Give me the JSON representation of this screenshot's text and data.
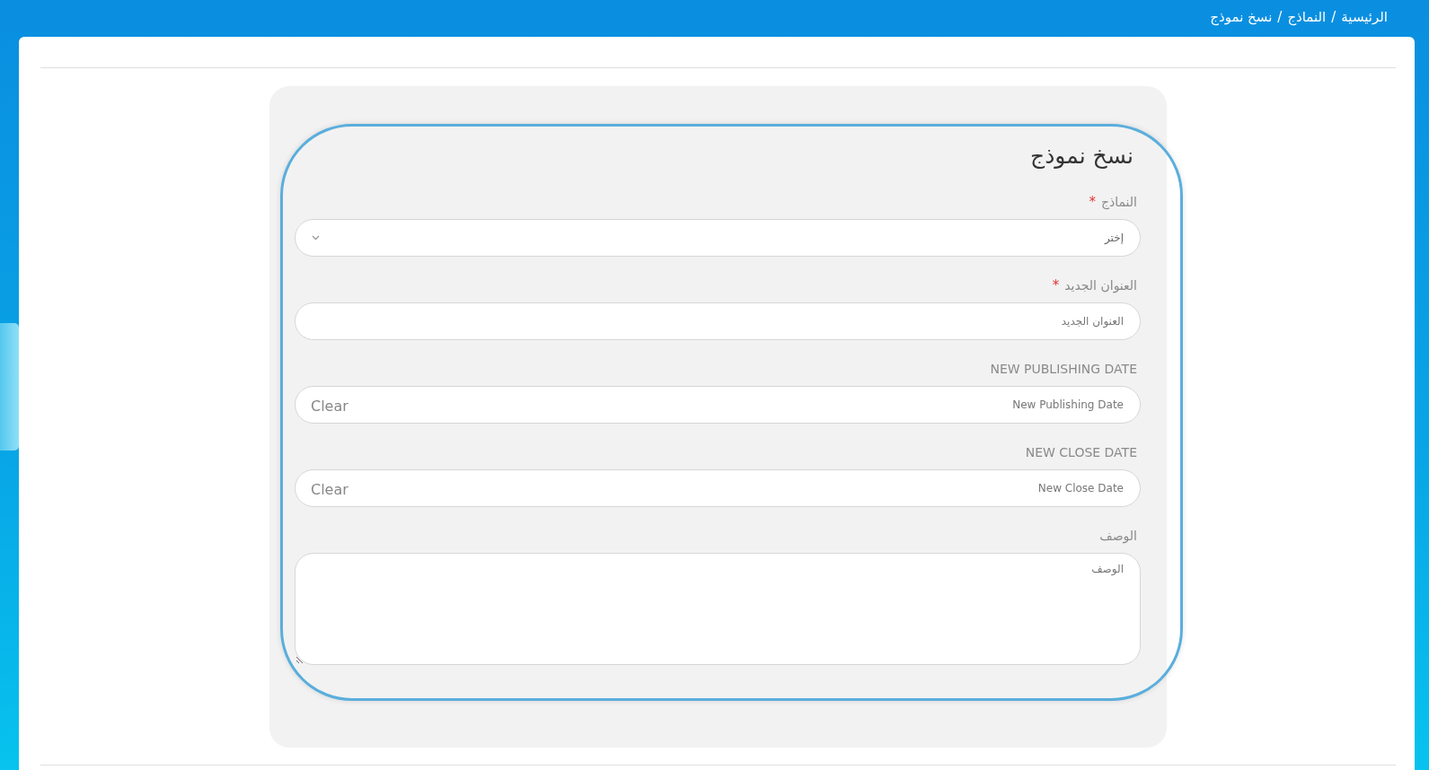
{
  "breadcrumb": {
    "items": [
      {
        "label": "الرئيسية"
      },
      {
        "label": "النماذج"
      },
      {
        "label": "نسخ نموذج"
      }
    ],
    "separators": [
      "/",
      "/"
    ]
  },
  "form": {
    "title": "نسخ نموذج",
    "fields": [
      {
        "kind": "select",
        "label": "النماذج",
        "required_mark": "*",
        "placeholder": "إختر"
      },
      {
        "kind": "text",
        "label": "العنوان الجديد",
        "required_mark": "*",
        "placeholder": "العنوان الجديد"
      },
      {
        "kind": "date",
        "label": "NEW PUBLISHING DATE",
        "placeholder": "New Publishing Date",
        "clear": "Clear"
      },
      {
        "kind": "date",
        "label": "NEW CLOSE DATE",
        "placeholder": "New Close Date",
        "clear": "Clear"
      },
      {
        "kind": "textarea",
        "label": "الوصف",
        "placeholder": "الوصف"
      }
    ]
  }
}
